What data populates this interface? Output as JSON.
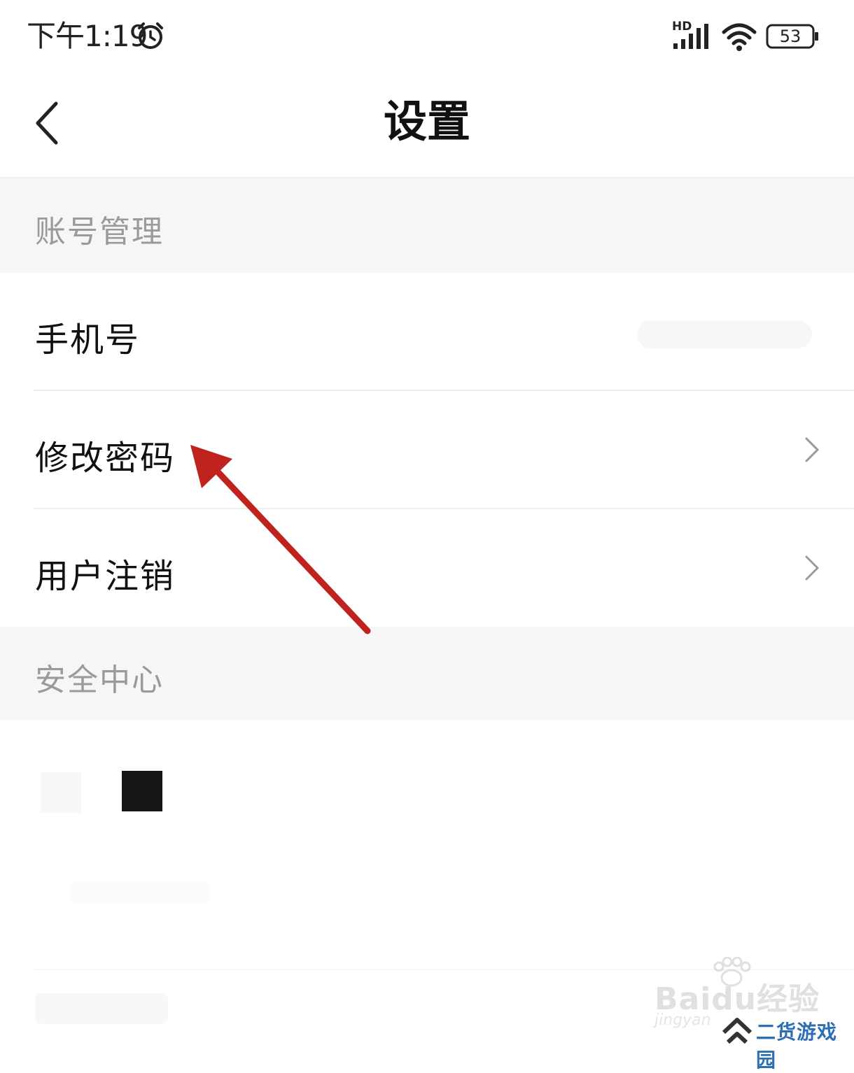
{
  "status_bar": {
    "time": "下午1:19",
    "network_label": "HD",
    "battery": "53"
  },
  "nav": {
    "title": "设置"
  },
  "sections": [
    {
      "header": "账号管理",
      "items": [
        {
          "label": "手机号"
        },
        {
          "label": "修改密码"
        },
        {
          "label": "用户注销"
        }
      ]
    },
    {
      "header": "安全中心"
    }
  ],
  "watermark": {
    "baidu": "Baidu经验",
    "jingyan": "jingyan",
    "site": "二货游戏园"
  },
  "colors": {
    "annotation_arrow": "#c0221e",
    "section_bg": "#f6f6f6",
    "site_logo": "#2c6fb5"
  }
}
